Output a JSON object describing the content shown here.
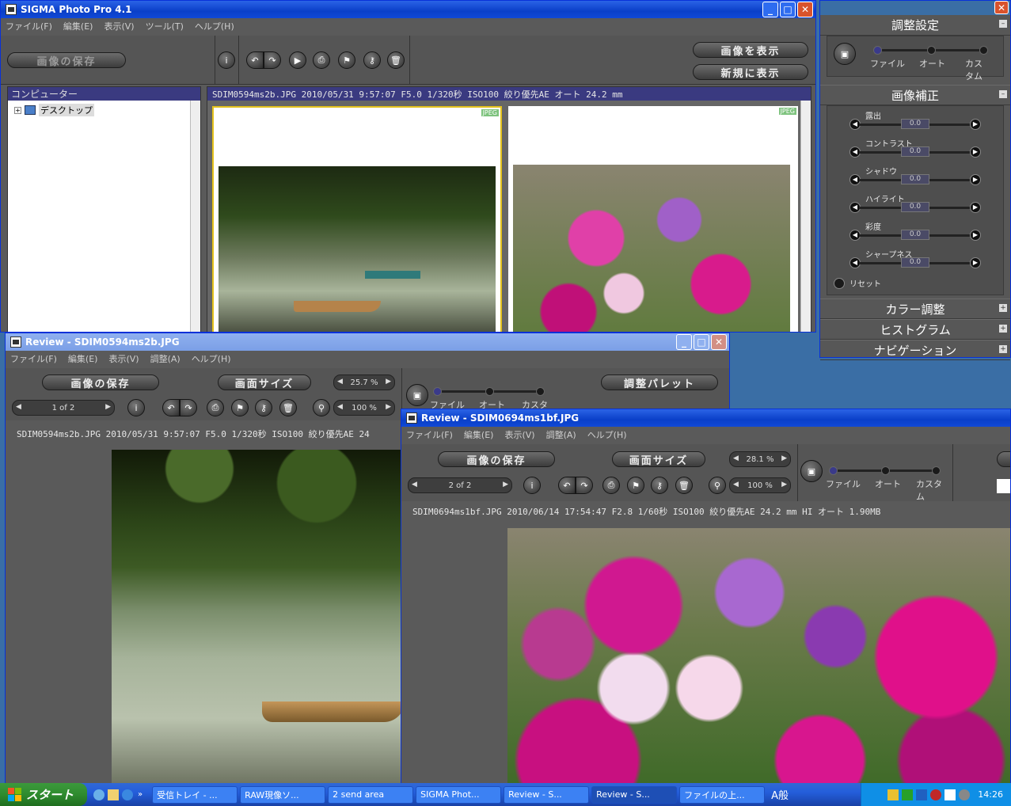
{
  "main": {
    "title": "SIGMA Photo Pro 4.1",
    "menu": [
      "ファイル(F)",
      "編集(E)",
      "表示(V)",
      "ツール(T)",
      "ヘルプ(H)"
    ],
    "save_btn": "画像の保存",
    "show_btn": "画像を表示",
    "new_btn": "新規に表示",
    "tree_header": "コンピューター",
    "tree_item": "デスクトップ",
    "info": "SDIM0594ms2b.JPG 2010/05/31 9:57:07 F5.0 1/320秒 ISO100 絞り優先AE オート 24.2 mm",
    "badge": "JPEG"
  },
  "palette": {
    "title": "調整設定",
    "modes": [
      "ファイル",
      "オート",
      "カスタム"
    ],
    "correction_title": "画像補正",
    "sliders": [
      {
        "label": "露出",
        "value": "0.0"
      },
      {
        "label": "コントラスト",
        "value": "0.0"
      },
      {
        "label": "シャドウ",
        "value": "0.0"
      },
      {
        "label": "ハイライト",
        "value": "0.0"
      },
      {
        "label": "彩度",
        "value": "0.0"
      },
      {
        "label": "シャープネス",
        "value": "0.0"
      }
    ],
    "reset": "リセット",
    "sections": [
      "カラー調整",
      "ヒストグラム",
      "ナビゲーション"
    ]
  },
  "review1": {
    "title": "Review - SDIM0594ms2b.JPG",
    "menu": [
      "ファイル(F)",
      "編集(E)",
      "表示(V)",
      "調整(A)",
      "ヘルプ(H)"
    ],
    "save_btn": "画像の保存",
    "size_btn": "画面サイズ",
    "zoom": "25.7 %",
    "palette_btn": "調整パレット",
    "page": "1 of 2",
    "zoom2": "100 %",
    "modes": [
      "ファイル",
      "オート",
      "カスタム"
    ],
    "info": "SDIM0594ms2b.JPG 2010/05/31 9:57:07 F5.0 1/320秒 ISO100 絞り優先AE 24"
  },
  "review2": {
    "title": "Review - SDIM0694ms1bf.JPG",
    "menu": [
      "ファイル(F)",
      "編集(E)",
      "表示(V)",
      "調整(A)",
      "ヘルプ(H)"
    ],
    "save_btn": "画像の保存",
    "size_btn": "画面サイズ",
    "zoom": "28.1 %",
    "page": "2 of 2",
    "zoom2": "100 %",
    "modes": [
      "ファイル",
      "オート",
      "カスタム"
    ],
    "info": "SDIM0694ms1bf.JPG 2010/06/14 17:54:47 F2.8 1/60秒 ISO100 絞り優先AE 24.2 mm HI オート 1.90MB"
  },
  "taskbar": {
    "start": "スタート",
    "items": [
      "受信トレイ - ...",
      "RAW現像ソ...",
      "2 send area",
      "SIGMA Phot...",
      "Review - S...",
      "Review - S...",
      "ファイルの上..."
    ],
    "ime": "A般",
    "clock": "14:26"
  }
}
